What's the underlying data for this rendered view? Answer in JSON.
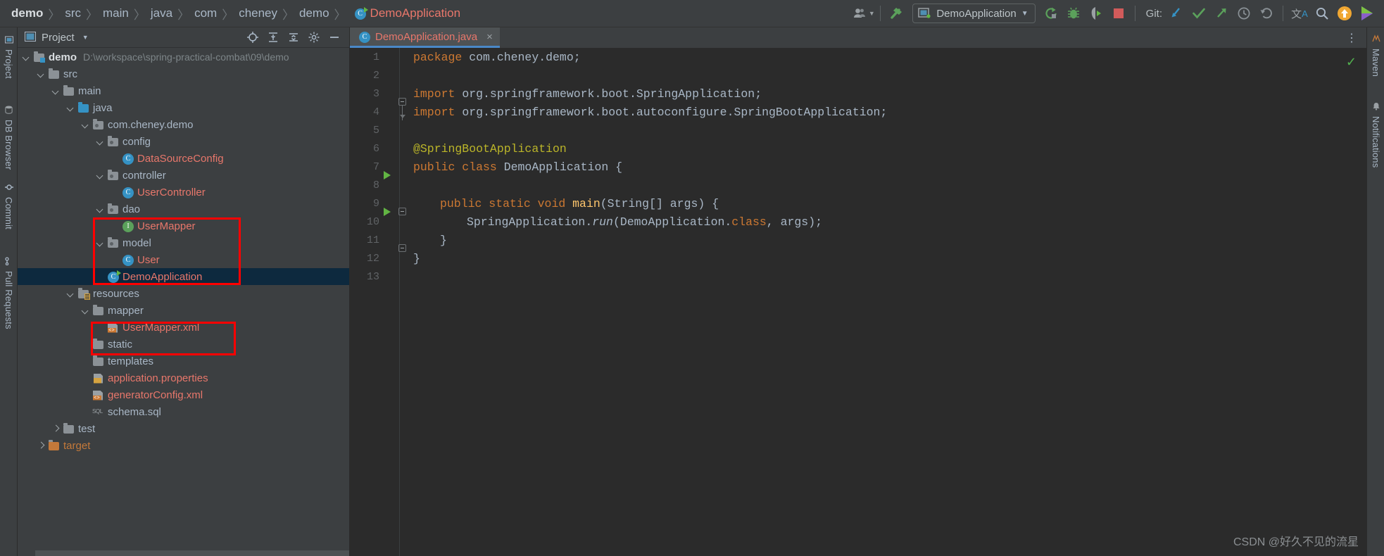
{
  "breadcrumb": {
    "items": [
      {
        "label": "demo",
        "style": "bold"
      },
      {
        "label": "src",
        "style": "normal"
      },
      {
        "label": "main",
        "style": "normal"
      },
      {
        "label": "java",
        "style": "normal"
      },
      {
        "label": "com",
        "style": "normal"
      },
      {
        "label": "cheney",
        "style": "normal"
      },
      {
        "label": "demo",
        "style": "normal"
      },
      {
        "label": "DemoApplication",
        "style": "accent"
      }
    ],
    "separator": "〉"
  },
  "toolbar": {
    "run_config_label": "DemoApplication",
    "run_config_caret": "▼",
    "git_label": "Git:",
    "user_icon": "user-icon",
    "user_caret": "▼",
    "build_icon": "build-hammer-icon",
    "run_icon": "run-icon",
    "debug_icon": "debug-icon",
    "coverage_icon": "run-with-coverage-icon",
    "stop_icon": "stop-icon",
    "update_project_icon": "git-update-icon",
    "commit_icon": "git-commit-icon",
    "push_icon": "git-push-icon",
    "history_icon": "git-history-icon",
    "rollback_icon": "git-rollback-icon",
    "translate_icon": "translate-icon",
    "search_icon": "search-everywhere-icon",
    "upload_icon": "upload-icon",
    "plugin_icon": "plugin-icon"
  },
  "left_rail": [
    {
      "label": "Project",
      "icon": "project-icon"
    },
    {
      "label": "DB Browser",
      "icon": "database-icon"
    },
    {
      "label": "Commit",
      "icon": "commit-icon"
    },
    {
      "label": "Pull Requests",
      "icon": "pull-request-icon"
    }
  ],
  "right_rail": [
    {
      "label": "Maven",
      "icon": "maven-icon"
    },
    {
      "label": "Notifications",
      "icon": "bell-icon"
    }
  ],
  "project_panel": {
    "title": "Project",
    "caret": "▼",
    "header_icons": [
      "locate-icon",
      "collapse-all-icon",
      "expand-icon",
      "settings-gear-icon",
      "hide-icon"
    ],
    "tree": [
      {
        "depth": 0,
        "label": "demo",
        "suffix": "D:\\workspace\\spring-practical-combat\\09\\demo",
        "icon": "module-folder-icon",
        "arrow": "open",
        "style": "bold"
      },
      {
        "depth": 1,
        "label": "src",
        "icon": "folder-icon",
        "arrow": "open",
        "style": "normal"
      },
      {
        "depth": 2,
        "label": "main",
        "icon": "folder-icon",
        "arrow": "open",
        "style": "normal"
      },
      {
        "depth": 3,
        "label": "java",
        "icon": "source-folder-icon",
        "arrow": "open",
        "style": "normal"
      },
      {
        "depth": 4,
        "label": "com.cheney.demo",
        "icon": "package-icon",
        "arrow": "open",
        "style": "normal"
      },
      {
        "depth": 5,
        "label": "config",
        "icon": "package-icon",
        "arrow": "open",
        "style": "normal"
      },
      {
        "depth": 6,
        "label": "DataSourceConfig",
        "icon": "java-class-icon",
        "arrow": "none",
        "style": "red"
      },
      {
        "depth": 5,
        "label": "controller",
        "icon": "package-icon",
        "arrow": "open",
        "style": "normal"
      },
      {
        "depth": 6,
        "label": "UserController",
        "icon": "java-class-icon",
        "arrow": "none",
        "style": "red"
      },
      {
        "depth": 5,
        "label": "dao",
        "icon": "package-icon",
        "arrow": "open",
        "style": "normal"
      },
      {
        "depth": 6,
        "label": "UserMapper",
        "icon": "java-interface-icon",
        "arrow": "none",
        "style": "red"
      },
      {
        "depth": 5,
        "label": "model",
        "icon": "package-icon",
        "arrow": "open",
        "style": "normal"
      },
      {
        "depth": 6,
        "label": "User",
        "icon": "java-class-icon",
        "arrow": "none",
        "style": "red"
      },
      {
        "depth": 5,
        "label": "DemoApplication",
        "icon": "spring-runnable-class-icon",
        "arrow": "none",
        "style": "red",
        "selected": true
      },
      {
        "depth": 3,
        "label": "resources",
        "icon": "resource-folder-icon",
        "arrow": "open",
        "style": "normal"
      },
      {
        "depth": 4,
        "label": "mapper",
        "icon": "folder-icon",
        "arrow": "open",
        "style": "normal"
      },
      {
        "depth": 5,
        "label": "UserMapper.xml",
        "icon": "xml-file-icon",
        "arrow": "none",
        "style": "red"
      },
      {
        "depth": 4,
        "label": "static",
        "icon": "folder-icon",
        "arrow": "none",
        "style": "normal"
      },
      {
        "depth": 4,
        "label": "templates",
        "icon": "folder-icon",
        "arrow": "none",
        "style": "normal"
      },
      {
        "depth": 4,
        "label": "application.properties",
        "icon": "properties-file-icon",
        "arrow": "none",
        "style": "red"
      },
      {
        "depth": 4,
        "label": "generatorConfig.xml",
        "icon": "xml-file-icon",
        "arrow": "none",
        "style": "red"
      },
      {
        "depth": 4,
        "label": "schema.sql",
        "icon": "sql-file-icon",
        "arrow": "none",
        "style": "normal"
      },
      {
        "depth": 2,
        "label": "test",
        "icon": "folder-icon",
        "arrow": "closed",
        "style": "normal"
      },
      {
        "depth": 1,
        "label": "target",
        "icon": "folder-icon",
        "arrow": "closed",
        "style": "orange"
      }
    ]
  },
  "editor": {
    "tab": {
      "label": "DemoApplication.java",
      "icon": "java-class-icon",
      "close": "×"
    },
    "more_icon": "⋮",
    "inspection_ok": "✓",
    "lines": [
      {
        "no": "1",
        "tokens": [
          {
            "t": "package",
            "c": "k"
          },
          {
            "t": " com.cheney.demo;",
            "c": "s"
          }
        ]
      },
      {
        "no": "2",
        "tokens": []
      },
      {
        "no": "3",
        "fold": "start",
        "tokens": [
          {
            "t": "import",
            "c": "k"
          },
          {
            "t": " org.springframework.boot.SpringApplication;",
            "c": "s"
          }
        ]
      },
      {
        "no": "4",
        "fold": "end",
        "tokens": [
          {
            "t": "import",
            "c": "k"
          },
          {
            "t": " org.springframework.boot.autoconfigure.SpringBootApplication;",
            "c": "s"
          }
        ]
      },
      {
        "no": "5",
        "tokens": []
      },
      {
        "no": "6",
        "tokens": [
          {
            "t": "@SpringBootApplication",
            "c": "a"
          }
        ]
      },
      {
        "no": "7",
        "run": true,
        "tokens": [
          {
            "t": "public class",
            "c": "k"
          },
          {
            "t": " DemoApplication {",
            "c": "s"
          }
        ]
      },
      {
        "no": "8",
        "tokens": []
      },
      {
        "no": "9",
        "run": true,
        "fold": "start2",
        "indent": 1,
        "tokens": [
          {
            "t": "public static",
            "c": "k"
          },
          {
            "t": " ",
            "c": "s"
          },
          {
            "t": "void",
            "c": "k"
          },
          {
            "t": " ",
            "c": "s"
          },
          {
            "t": "main",
            "c": "fn"
          },
          {
            "t": "(String[] args) {",
            "c": "s"
          }
        ]
      },
      {
        "no": "10",
        "indent": 2,
        "tokens": [
          {
            "t": "SpringApplication.",
            "c": "s"
          },
          {
            "t": "run",
            "c": "it"
          },
          {
            "t": "(DemoApplication.",
            "c": "s"
          },
          {
            "t": "class",
            "c": "k"
          },
          {
            "t": ", args);",
            "c": "s"
          }
        ]
      },
      {
        "no": "11",
        "fold": "end2",
        "indent": 1,
        "tokens": [
          {
            "t": "}",
            "c": "s"
          }
        ]
      },
      {
        "no": "12",
        "tokens": [
          {
            "t": "}",
            "c": "s"
          }
        ]
      },
      {
        "no": "13",
        "tokens": []
      }
    ]
  },
  "watermark": "CSDN @好久不见的流星",
  "colors": {
    "accent_red": "#e8776b",
    "selection": "#0d293e",
    "highlight_box": "#ff0000",
    "editor_bg": "#2b2b2b",
    "panel_bg": "#3c3f41"
  }
}
